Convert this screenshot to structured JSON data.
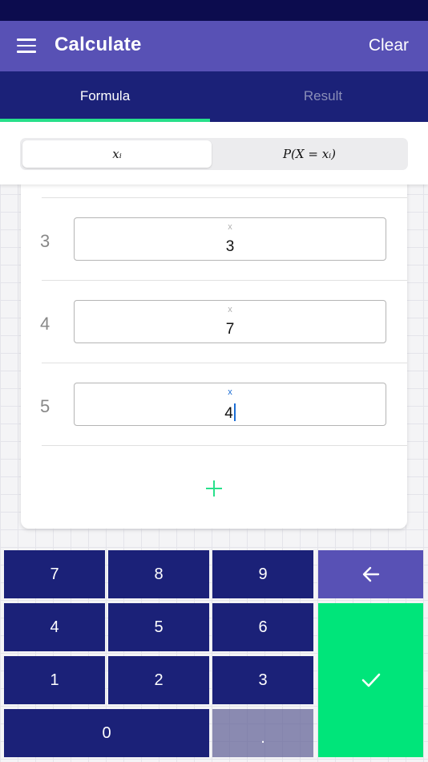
{
  "appbar": {
    "title": "Calculate",
    "clear_label": "Clear",
    "menu_icon": "menu-icon"
  },
  "tabs": [
    {
      "label": "Formula",
      "active": true
    },
    {
      "label": "Result",
      "active": false
    }
  ],
  "segmented": {
    "options": [
      {
        "label": "xᵢ",
        "selected": true
      },
      {
        "label": "P(X = xᵢ)",
        "selected": false
      }
    ]
  },
  "rows": [
    {
      "index": "3",
      "field_label": "x",
      "value": "3",
      "focused": false
    },
    {
      "index": "4",
      "field_label": "x",
      "value": "7",
      "focused": false
    },
    {
      "index": "5",
      "field_label": "x",
      "value": "4",
      "focused": true
    }
  ],
  "add_icon": "plus-icon",
  "keypad": {
    "keys": [
      "7",
      "8",
      "9",
      "4",
      "5",
      "6",
      "1",
      "2",
      "3",
      "0",
      "."
    ],
    "backspace_icon": "arrow-left-icon",
    "confirm_icon": "check-icon"
  },
  "colors": {
    "status_bar": "#0c0c4e",
    "app_bar": "#5851b5",
    "tab_bar": "#1b2178",
    "accent_green": "#27e08b",
    "key_blue": "#1b2178",
    "key_purple": "#5851b5",
    "key_green": "#00e57a",
    "key_dot": "#8080a8",
    "focus_blue": "#1b6dd4"
  }
}
